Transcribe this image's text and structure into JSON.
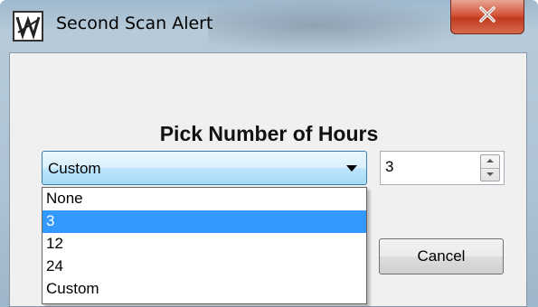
{
  "window": {
    "title": "Second Scan Alert",
    "close_symbol": "✕",
    "icon": "app-logo-icon"
  },
  "dialog": {
    "heading": "Pick Number of Hours",
    "hours_combo": {
      "selected": "Custom",
      "options": [
        "None",
        "3",
        "12",
        "24",
        "Custom"
      ],
      "highlighted": "3"
    },
    "hours_spinner": {
      "value": "3"
    },
    "cancel_label": "Cancel"
  },
  "colors": {
    "highlight": "#3399ff",
    "close_button": "#c8462b"
  }
}
